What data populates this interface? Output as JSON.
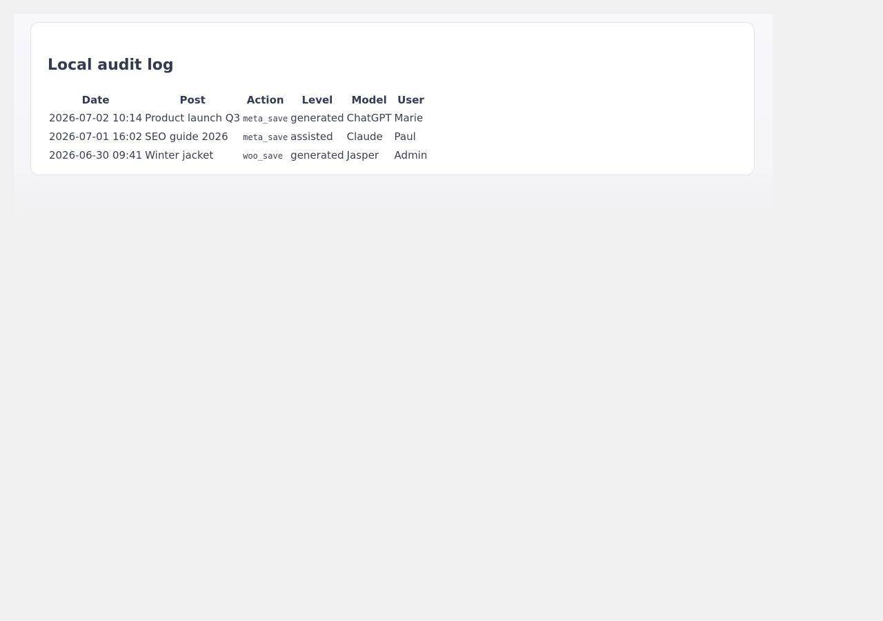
{
  "card": {
    "title": "Local audit log"
  },
  "table": {
    "columns": [
      "Date",
      "Post",
      "Action",
      "Level",
      "Model",
      "User"
    ],
    "rows": [
      [
        "2026-07-02 10:14",
        "Product launch Q3",
        "meta_save",
        "generated",
        "ChatGPT",
        "Marie"
      ],
      [
        "2026-07-01 16:02",
        "SEO guide 2026",
        "meta_save",
        "assisted",
        "Claude",
        "Paul"
      ],
      [
        "2026-06-30 09:41",
        "Winter jacket",
        "woo_save",
        "generated",
        "Jasper",
        "Admin"
      ]
    ]
  }
}
